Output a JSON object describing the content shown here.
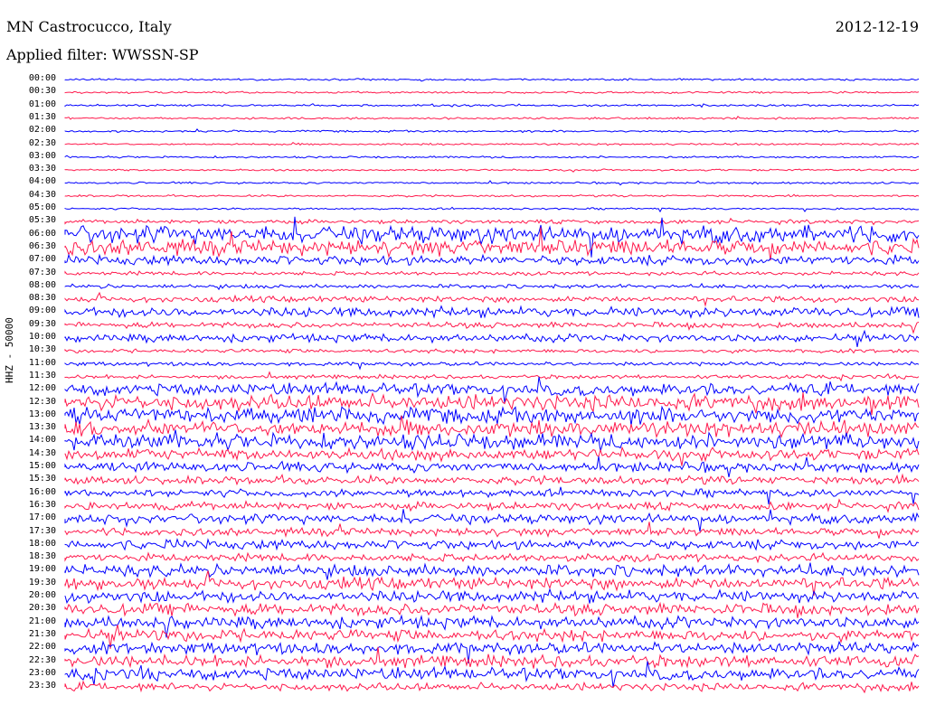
{
  "header": {
    "station": "MN Castrocucco, Italy",
    "date": "2012-12-19",
    "filter": "Applied filter: WWSSN-SP"
  },
  "chart_data": {
    "type": "line",
    "title": "MN Castrocucco, Italy",
    "ylabel": "HHZ - 50000",
    "colors": [
      "#0000ff",
      "#ff1a4d"
    ],
    "grid": false,
    "y_ticks": [
      "00:00",
      "00:30",
      "01:00",
      "01:30",
      "02:00",
      "02:30",
      "03:00",
      "03:30",
      "04:00",
      "04:30",
      "05:00",
      "05:30",
      "06:00",
      "06:30",
      "07:00",
      "07:30",
      "08:00",
      "08:30",
      "09:00",
      "09:30",
      "10:00",
      "10:30",
      "11:00",
      "11:30",
      "12:00",
      "12:30",
      "13:00",
      "13:30",
      "14:00",
      "14:30",
      "15:00",
      "15:30",
      "16:00",
      "16:30",
      "17:00",
      "17:30",
      "18:00",
      "18:30",
      "19:00",
      "19:30",
      "20:00",
      "20:30",
      "21:00",
      "21:30",
      "22:00",
      "22:30",
      "23:00",
      "23:30"
    ],
    "noise_amplitude": [
      1,
      1,
      1,
      1,
      1,
      1,
      1,
      1,
      1,
      1,
      1,
      2,
      9,
      8,
      5,
      2,
      2,
      3,
      5,
      3,
      4,
      2,
      2,
      2,
      6,
      8,
      8,
      8,
      8,
      6,
      5,
      4,
      4,
      4,
      5,
      4,
      5,
      4,
      6,
      6,
      6,
      6,
      6,
      6,
      6,
      6,
      6,
      4
    ]
  }
}
